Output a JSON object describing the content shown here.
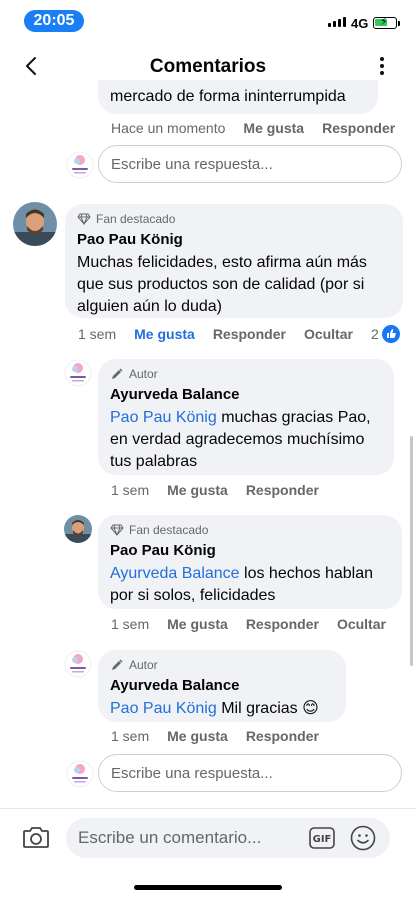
{
  "status_bar": {
    "time": "20:05",
    "network": "4G"
  },
  "header": {
    "title": "Comentarios",
    "back_icon": "chevron-left-icon",
    "more_icon": "more-vertical-icon"
  },
  "partial_comment": {
    "text": "mercado de forma ininterrumpida",
    "time": "Hace un momento",
    "like": "Me gusta",
    "reply": "Responder"
  },
  "reply_input_top": {
    "placeholder": "Escribe una respuesta..."
  },
  "comment_main": {
    "badge": "Fan destacado",
    "name": "Pao Pau König",
    "text": "Muchas felicidades, esto afirma aún más que sus productos son de calidad (por si alguien aún lo duda)",
    "time": "1 sem",
    "like": "Me gusta",
    "reply": "Responder",
    "hide": "Ocultar",
    "reactions": "2"
  },
  "reply1": {
    "badge": "Autor",
    "name": "Ayurveda Balance",
    "mention": "Pao Pau König",
    "text": " muchas gracias Pao, en verdad agradecemos muchísimo tus palabras",
    "time": "1 sem",
    "like": "Me gusta",
    "reply": "Responder"
  },
  "reply2": {
    "badge": "Fan destacado",
    "name": "Pao Pau König",
    "mention": "Ayurveda Balance",
    "text": " los hechos hablan por si solos, felicidades",
    "time": "1 sem",
    "like": "Me gusta",
    "reply": "Responder",
    "hide": "Ocultar"
  },
  "reply3": {
    "badge": "Autor",
    "name": "Ayurveda Balance",
    "mention": "Pao Pau König",
    "text": " Mil gracias 😊",
    "time": "1 sem",
    "like": "Me gusta",
    "reply": "Responder"
  },
  "reply_input_bottom": {
    "placeholder": "Escribe una respuesta..."
  },
  "composer": {
    "placeholder": "Escribe un comentario...",
    "gif_label": "GIF"
  },
  "colors": {
    "accent": "#216fdb",
    "bubble": "#f0f2f5",
    "time_pill": "#1a7ef5"
  }
}
